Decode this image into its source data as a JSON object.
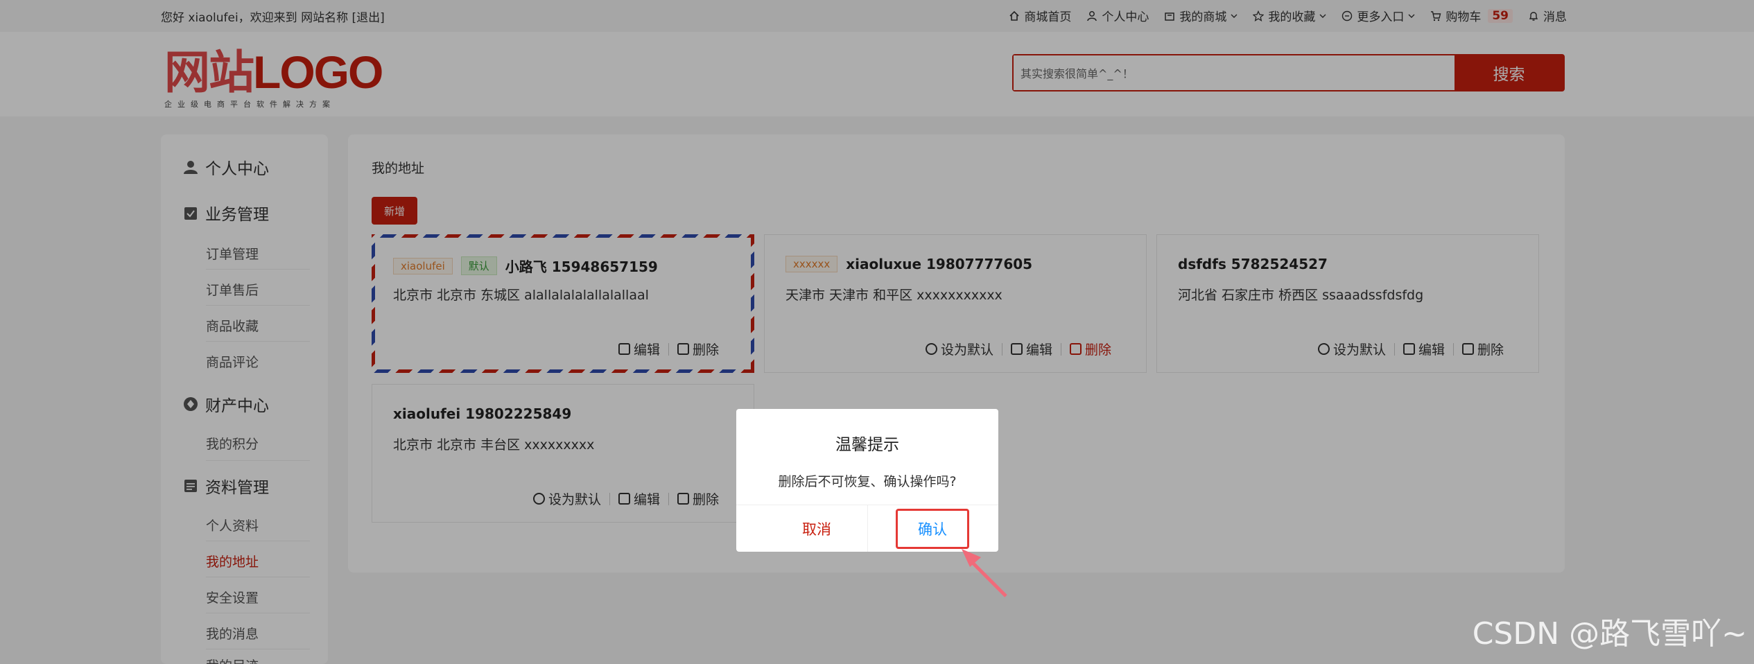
{
  "topbar": {
    "greeting": "您好 xiaolufei，欢迎来到 网站名称 [退出]",
    "nav": [
      {
        "label": "商城首页",
        "icon": "home-icon"
      },
      {
        "label": "个人中心",
        "icon": "user-icon"
      },
      {
        "label": "我的商城",
        "icon": "shop-icon"
      },
      {
        "label": "我的收藏",
        "icon": "star-icon"
      },
      {
        "label": "更多入口",
        "icon": "more-icon"
      },
      {
        "label": "购物车",
        "icon": "cart-icon",
        "count": "59"
      },
      {
        "label": "消息",
        "icon": "bell-icon"
      }
    ]
  },
  "header": {
    "logo_cn": "网站",
    "logo_en": "LOGO",
    "logo_sub": "企业级电商平台软件解决方案",
    "search_placeholder": "其实搜索很简单^_^！",
    "search_button": "搜索"
  },
  "sidebar": {
    "groups": [
      {
        "label": "个人中心",
        "icon": "user-icon",
        "items": []
      },
      {
        "label": "业务管理",
        "icon": "clipboard-icon",
        "items": [
          "订单管理",
          "订单售后",
          "商品收藏",
          "商品评论"
        ]
      },
      {
        "label": "财产中心",
        "icon": "wallet-icon",
        "items": [
          "我的积分"
        ]
      },
      {
        "label": "资料管理",
        "icon": "profile-icon",
        "items": [
          "个人资料",
          "我的地址",
          "安全设置",
          "我的消息",
          "我的足迹"
        ]
      }
    ],
    "active_item": "我的地址"
  },
  "main": {
    "title": "我的地址",
    "add_button": "新增",
    "addresses": [
      {
        "tag": "xiaolufei",
        "default_tag": "默认",
        "name_phone": "小路飞 15948657159",
        "address": "北京市 北京市 东城区 alallalalalallalallaal",
        "actions": [
          "编辑",
          "删除"
        ],
        "is_default": true
      },
      {
        "tag": "xxxxxx",
        "default_tag": "",
        "name_phone": "xiaoluxue 19807777605",
        "address": "天津市 天津市 和平区 xxxxxxxxxxx",
        "actions": [
          "设为默认",
          "编辑",
          "删除"
        ],
        "is_default": false
      },
      {
        "tag": "",
        "default_tag": "",
        "name_phone": "dsfdfs 5782524527",
        "address": "河北省 石家庄市 桥西区 ssaaadssfdsfdg",
        "actions": [
          "设为默认",
          "编辑",
          "删除"
        ],
        "is_default": false
      },
      {
        "tag": "",
        "default_tag": "",
        "name_phone": "xiaolufei 19802225849",
        "address": "北京市 北京市 丰台区 xxxxxxxxx",
        "actions": [
          "设为默认",
          "编辑",
          "删除"
        ],
        "is_default": false
      }
    ]
  },
  "dialog": {
    "title": "温馨提示",
    "message": "删除后不可恢复、确认操作吗?",
    "cancel": "取消",
    "confirm": "确认"
  },
  "watermark": "CSDN @路飞雪吖~",
  "colors": {
    "brand": "#c81f0f",
    "confirm_text": "#1890ff",
    "highlight_box": "#e53935"
  }
}
